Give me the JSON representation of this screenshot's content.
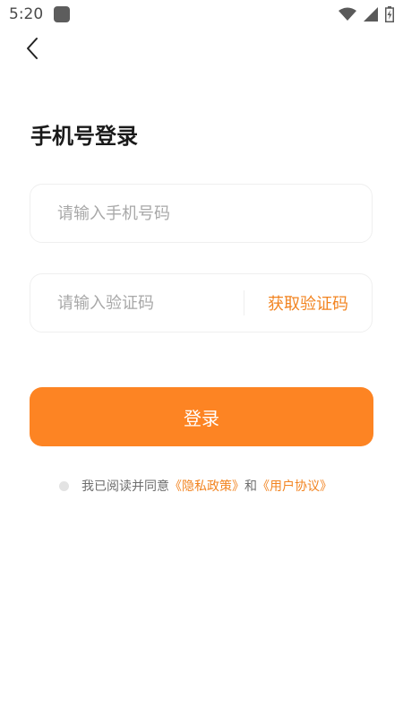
{
  "status_bar": {
    "time": "5:20"
  },
  "page": {
    "title": "手机号登录"
  },
  "phone": {
    "placeholder": "请输入手机号码"
  },
  "code": {
    "placeholder": "请输入验证码",
    "get_code_label": "获取验证码"
  },
  "login": {
    "label": "登录"
  },
  "agreement": {
    "prefix": "我已阅读并同意",
    "privacy": "《隐私政策》",
    "and": "和",
    "user_agreement": "《用户协议》"
  },
  "colors": {
    "accent": "#fd8423",
    "link": "#f28421"
  },
  "icons": {
    "back": "chevron-left-icon",
    "wifi": "wifi-icon",
    "signal": "signal-icon",
    "battery": "battery-icon"
  }
}
